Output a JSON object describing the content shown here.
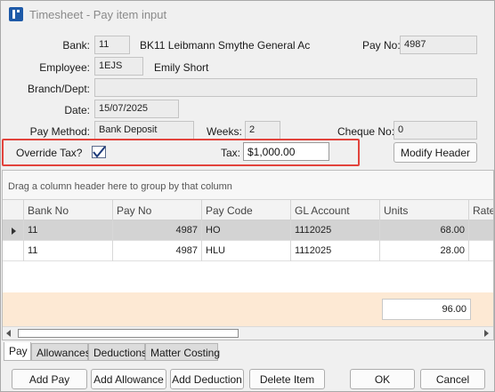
{
  "window": {
    "title": "Timesheet - Pay item input"
  },
  "header": {
    "bank_label": "Bank:",
    "bank_code": "11",
    "bank_name": "BK11 Leibmann Smythe General Ac",
    "pay_no_label": "Pay No:",
    "pay_no": "4987",
    "employee_label": "Employee:",
    "employee_code": "1EJS",
    "employee_name": "Emily Short",
    "branch_label": "Branch/Dept:",
    "branch_value": "",
    "date_label": "Date:",
    "date_value": "15/07/2025",
    "pay_method_label": "Pay Method:",
    "pay_method_value": "Bank Deposit",
    "weeks_label": "Weeks:",
    "weeks_value": "2",
    "cheque_label": "Cheque No:",
    "cheque_value": "0",
    "override_tax_label": "Override Tax?",
    "override_tax_checked": true,
    "tax_label": "Tax:",
    "tax_value": "$1,000.00",
    "modify_header_label": "Modify Header"
  },
  "grid": {
    "group_panel_text": "Drag a column header here to group by that column",
    "columns": [
      "Bank No",
      "Pay No",
      "Pay Code",
      "GL Account",
      "Units",
      "Rate"
    ],
    "rows": [
      {
        "bank_no": "11",
        "pay_no": "4987",
        "pay_code": "HO",
        "gl_account": "1112025",
        "units": "68.00",
        "selected": true
      },
      {
        "bank_no": "11",
        "pay_no": "4987",
        "pay_code": "HLU",
        "gl_account": "1112025",
        "units": "28.00",
        "selected": false
      }
    ],
    "units_total": "96.00"
  },
  "tabs": [
    {
      "label": "Pay",
      "active": true
    },
    {
      "label": "Allowances",
      "active": false
    },
    {
      "label": "Deductions",
      "active": false
    },
    {
      "label": "Matter Costing",
      "active": false
    }
  ],
  "buttons": {
    "add_pay": "Add Pay",
    "add_allowance": "Add Allowance",
    "add_deduction": "Add Deduction",
    "delete_item": "Delete Item",
    "ok": "OK",
    "cancel": "Cancel"
  },
  "colors": {
    "highlight": "#e2433c",
    "footer_band": "#fde9d4",
    "selected_row": "#d3d3d3",
    "app_icon": "#1e5aa8"
  },
  "icons": {
    "app": "app-logo-icon",
    "checkbox": "checkmark-icon",
    "row_pointer": "row-pointer-icon"
  }
}
